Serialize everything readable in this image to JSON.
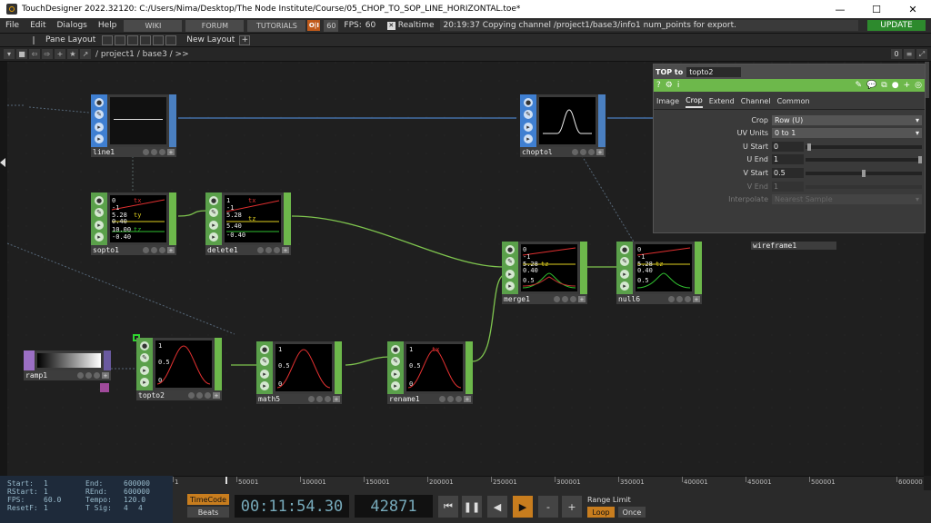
{
  "window": {
    "title": "TouchDesigner 2022.32120: C:/Users/Nima/Desktop/The Node Institute/Course/05_CHOP_TO_SOP_LINE_HORIZONTAL.toe*",
    "minimize": "—",
    "maximize": "☐",
    "close": "✕"
  },
  "menu": {
    "items": [
      "File",
      "Edit",
      "Dialogs",
      "Help"
    ],
    "wiki": "WIKI",
    "forum": "FORUM",
    "tutorials": "TUTORIALS",
    "oi": "O|I",
    "fps_cap": "60",
    "fps_label": "FPS:",
    "fps_value": "60",
    "realtime": "Realtime",
    "status": "20:19:37 Copying channel /project1/base3/info1 num_points for export.",
    "update": "UPDATE"
  },
  "panebar": {
    "pane_layout": "Pane Layout",
    "new_layout": "New Layout",
    "plus": "+"
  },
  "pathbar": {
    "path": "/ project1 / base3 / >>",
    "zero": "0"
  },
  "nodes": {
    "line1": "line1",
    "choptol": "choptol",
    "sopto1": "sopto1",
    "delete1": "delete1",
    "merge1": "merge1",
    "null6": "null6",
    "ramp1": "ramp1",
    "topto2": "topto2",
    "math5": "math5",
    "rename1": "rename1",
    "hidden_label": "wireframe1"
  },
  "viewer": {
    "sop_labels": {
      "tx": "tx",
      "ty": "ty",
      "tz": "tz",
      "v0": "0",
      "vm1": "-1",
      "v1": "1",
      "t1": "0.40",
      "t2": "-0.40",
      "t3": "5.28",
      "t4": "-5.28",
      "t5": "10.00",
      "t6": "5.40"
    },
    "chop_labels": {
      "one": "1",
      "half": "0.5",
      "zero": "0",
      "tx": "tx",
      "tz": "tz",
      "ty": "ty"
    }
  },
  "params": {
    "op_type": "TOP to",
    "op_name": "topto2",
    "tabs": [
      "Image",
      "Crop",
      "Extend",
      "Channel",
      "Common"
    ],
    "active_tab": "Crop",
    "rows": {
      "crop": {
        "label": "Crop",
        "value": "Row (U)"
      },
      "uv_units": {
        "label": "UV Units",
        "value": "0 to 1"
      },
      "u_start": {
        "label": "U Start",
        "value": "0"
      },
      "u_end": {
        "label": "U End",
        "value": "1"
      },
      "v_start": {
        "label": "V Start",
        "value": "0.5"
      },
      "v_end": {
        "label": "V End",
        "value": "1"
      },
      "interpolate": {
        "label": "Interpolate",
        "value": "Nearest Sample"
      }
    }
  },
  "timeline": {
    "ticks": [
      "1",
      "50001",
      "100001",
      "150001",
      "200001",
      "250001",
      "300001",
      "350001",
      "400001",
      "450001",
      "500001",
      "600000"
    ]
  },
  "stats": {
    "start_l": "Start:",
    "start": "1",
    "end_l": "End:",
    "end": "600000",
    "rstart_l": "RStart:",
    "rstart": "1",
    "rend_l": "REnd:",
    "rend": "600000",
    "fps_l": "FPS:",
    "fps": "60.0",
    "tempo_l": "Tempo:",
    "tempo": "120.0",
    "resetf_l": "ResetF:",
    "resetf": "1",
    "tsig_l": "T Sig:",
    "tsig_a": "4",
    "tsig_b": "4"
  },
  "transport": {
    "timecode": "TimeCode",
    "beats": "Beats",
    "time": "00:11:54.30",
    "frame": "42871",
    "range_limit": "Range Limit",
    "loop": "Loop",
    "once": "Once",
    "rewind": "⏮",
    "pause": "❚❚",
    "back": "◀",
    "play": "▶",
    "minus": "-",
    "plus": "+"
  }
}
